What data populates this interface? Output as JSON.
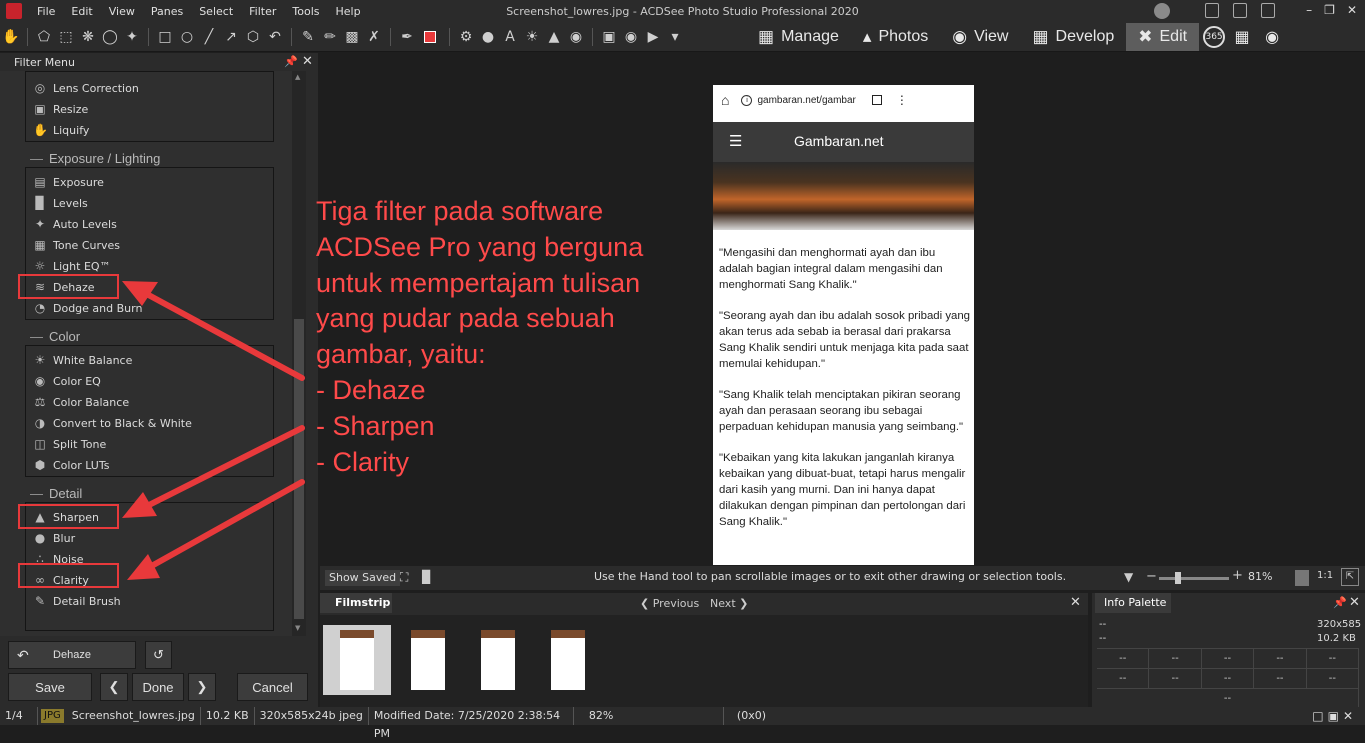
{
  "window": {
    "title": "Screenshot_lowres.jpg - ACDSee Photo Studio Professional 2020",
    "menu": [
      "File",
      "Edit",
      "View",
      "Panes",
      "Select",
      "Filter",
      "Tools",
      "Help"
    ]
  },
  "modes": {
    "manage": "Manage",
    "photos": "Photos",
    "view": "View",
    "develop": "Develop",
    "edit": "Edit",
    "badge_365": "365"
  },
  "filter_panel": {
    "title": "Filter Menu",
    "geometry_items": [
      "Lens Correction",
      "Resize",
      "Liquify"
    ],
    "exposure_title": "Exposure / Lighting",
    "exposure_items": [
      "Exposure",
      "Levels",
      "Auto Levels",
      "Tone Curves",
      "Light EQ™",
      "Dehaze",
      "Dodge and Burn"
    ],
    "color_title": "Color",
    "color_items": [
      "White Balance",
      "Color EQ",
      "Color Balance",
      "Convert to Black & White",
      "Split Tone",
      "Color LUTs"
    ],
    "detail_title": "Detail",
    "detail_items": [
      "Sharpen",
      "Blur",
      "Noise",
      "Clarity",
      "Detail Brush"
    ]
  },
  "bottom_buttons": {
    "undo_label": "Dehaze",
    "save": "Save",
    "done": "Done",
    "cancel": "Cancel"
  },
  "annotation": "Tiga filter pada software\nACDSee Pro yang berguna\nuntuk mempertajam tulisan\nyang pudar pada sebuah\ngambar, yaitu:\n- Dehaze\n- Sharpen\n- Clarity",
  "phone": {
    "url": "gambaran.net/gambar",
    "site_name": "Gambaran.net",
    "paragraphs": [
      "\"Mengasihi dan menghormati ayah dan ibu adalah bagian integral dalam mengasihi dan menghormati Sang Khalik.\"",
      "\"Seorang ayah dan ibu adalah sosok pribadi yang akan terus ada sebab ia berasal dari prakarsa Sang Khalik sendiri untuk menjaga kita pada saat memulai kehidupan.\"",
      "\"Sang Khalik telah menciptakan pikiran seorang ayah dan perasaan seorang ibu sebagai perpaduan kehidupan manusia yang seimbang.\"",
      "\"Kebaikan yang kita lakukan janganlah kiranya kebaikan yang dibuat-buat, tetapi harus mengalir dari kasih yang murni. Dan ini hanya dapat dilakukan dengan pimpinan dan pertolongan dari Sang Khalik.\""
    ]
  },
  "status_row": {
    "show_saved": "Show Saved",
    "hint": "Use the Hand tool to pan scrollable images or to exit other drawing or selection tools.",
    "zoom": "81%",
    "one_to_one": "1:1",
    "zoom_level": 0.81
  },
  "filmstrip": {
    "tab": "Filmstrip",
    "previous": "Previous",
    "next": "Next"
  },
  "info_palette": {
    "tab": "Info Palette",
    "left1": "--",
    "left2": "--",
    "dims": "320x585",
    "size": "10.2 KB",
    "row1": [
      "--",
      "--",
      "--",
      "--",
      "--"
    ],
    "row2": [
      "--",
      "--",
      "--",
      "--",
      "--"
    ],
    "row3": "--"
  },
  "statusbar": {
    "index": "1/4",
    "type": "JPG",
    "filename": "Screenshot_lowres.jpg",
    "filesize": "10.2 KB",
    "dims": "320x585x24b jpeg",
    "modified": "Modified Date: 7/25/2020 2:38:54 PM",
    "zoom": "82%",
    "coords": "(0x0)"
  },
  "colors": {
    "accent_red": "#e8393b",
    "annotation_red": "#ff4a4a",
    "panel_bg": "#2b2b2b"
  }
}
